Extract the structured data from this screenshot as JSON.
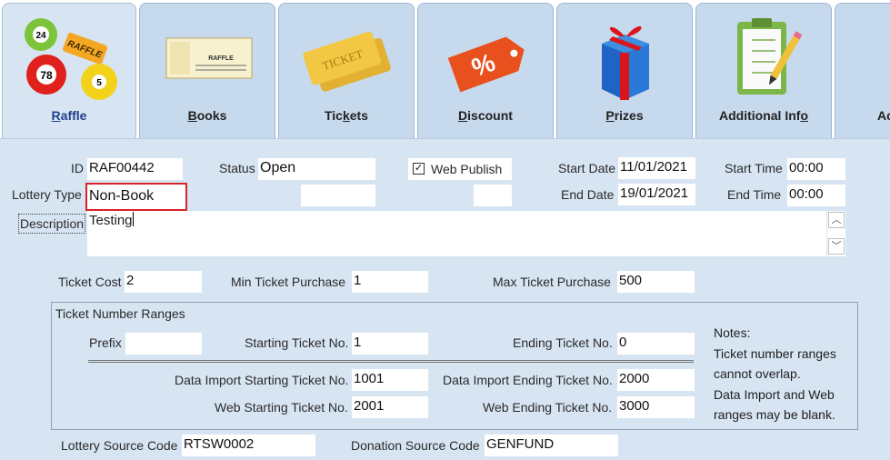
{
  "tabs": [
    {
      "label_pre": "",
      "label_u": "R",
      "label_post": "affle",
      "icon": "raffle-balls-icon",
      "active": true
    },
    {
      "label_pre": "",
      "label_u": "B",
      "label_post": "ooks",
      "icon": "raffle-book-icon",
      "active": false
    },
    {
      "label_pre": "Tic",
      "label_u": "k",
      "label_post": "ets",
      "icon": "ticket-icon",
      "active": false
    },
    {
      "label_pre": "",
      "label_u": "D",
      "label_post": "iscount",
      "icon": "discount-tag-icon",
      "active": false
    },
    {
      "label_pre": "",
      "label_u": "P",
      "label_post": "rizes",
      "icon": "gift-box-icon",
      "active": false
    },
    {
      "label_pre": "Additional Inf",
      "label_u": "o",
      "label_post": "",
      "icon": "clipboard-icon",
      "active": false
    },
    {
      "label_pre": "Ac",
      "label_u": "",
      "label_post": "",
      "icon": "",
      "active": false
    }
  ],
  "icon_text": {
    "ball1": "24",
    "ball2": "78",
    "ball3": "5",
    "raffle_tag": "RAFFLE",
    "book_title": "RAFFLE",
    "ticket_word": "TICKET",
    "percent": "%"
  },
  "form": {
    "id_label": "ID",
    "id_value": "RAF00442",
    "status_label": "Status",
    "status_value": "Open",
    "web_publish_label": "Web Publish",
    "web_publish_checked": true,
    "start_date_label": "Start Date",
    "start_date_value": "11/01/2021",
    "start_time_label": "Start Time",
    "start_time_value": "00:00",
    "lottery_type_label": "Lottery Type",
    "lottery_type_value": "Non-Book",
    "end_date_label": "End Date",
    "end_date_value": "19/01/2021",
    "end_time_label": "End Time",
    "end_time_value": "00:00",
    "description_label": "Description",
    "description_value": "Testing",
    "ticket_cost_label": "Ticket Cost",
    "ticket_cost_value": "2",
    "min_purchase_label": "Min Ticket Purchase",
    "min_purchase_value": "1",
    "max_purchase_label": "Max Ticket Purchase",
    "max_purchase_value": "500"
  },
  "ranges": {
    "title": "Ticket Number Ranges",
    "prefix_label": "Prefix",
    "prefix_value": "",
    "starting_label": "Starting Ticket No.",
    "starting_value": "1",
    "ending_label": "Ending Ticket No.",
    "ending_value": "0",
    "di_start_label": "Data Import Starting Ticket No.",
    "di_start_value": "1001",
    "di_end_label": "Data Import Ending Ticket No.",
    "di_end_value": "2000",
    "web_start_label": "Web Starting Ticket No.",
    "web_start_value": "2001",
    "web_end_label": "Web Ending Ticket No.",
    "web_end_value": "3000",
    "notes": [
      "Notes:",
      "Ticket number ranges",
      "cannot overlap.",
      "Data Import and Web",
      "ranges may be blank."
    ]
  },
  "source": {
    "lottery_label": "Lottery Source Code",
    "lottery_value": "RTSW0002",
    "donation_label": "Donation Source Code",
    "donation_value": "GENFUND"
  },
  "colors": {
    "highlight": "#d9212a",
    "active_tab_text": "#1f3f8a",
    "panel_bg": "#d7e5f3"
  }
}
